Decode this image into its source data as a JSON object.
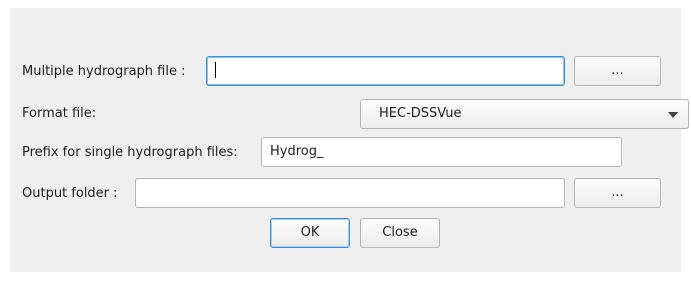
{
  "form": {
    "multiple_hydrograph_label": "Multiple hydrograph file :",
    "multiple_hydrograph_value": "",
    "browse_hydrograph_label": "...",
    "format_label": "Format file:",
    "format_selected": "HEC-DSSVue",
    "prefix_label": "Prefix for single hydrograph files:",
    "prefix_value": "Hydrog_",
    "output_folder_label": "Output folder :",
    "output_folder_value": "",
    "browse_output_label": "..."
  },
  "buttons": {
    "ok_label": "OK",
    "close_label": "Close"
  },
  "icons": {
    "combo_arrow": "chevron-down-icon",
    "caret": "text-cursor"
  },
  "colors": {
    "dialog_background": "#efefef",
    "focus_border": "#3b8fd8"
  }
}
